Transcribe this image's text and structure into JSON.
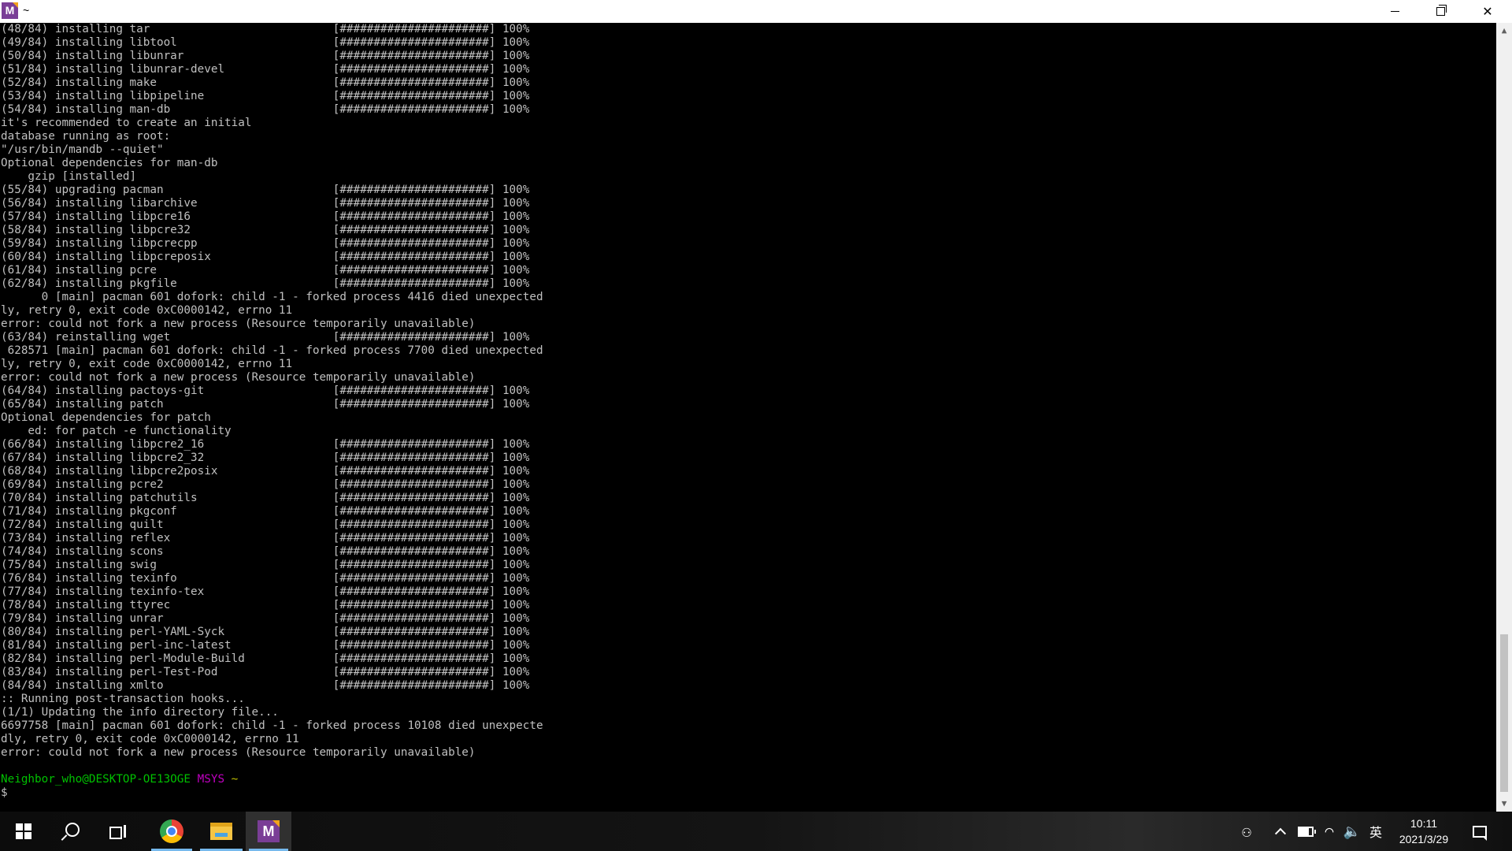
{
  "window": {
    "title": "~",
    "app_icon_letter": "M",
    "close_glyph": "✕"
  },
  "terminal": {
    "lines": [
      "(48/84) installing tar                           [######################] 100%",
      "(49/84) installing libtool                       [######################] 100%",
      "(50/84) installing libunrar                      [######################] 100%",
      "(51/84) installing libunrar-devel                [######################] 100%",
      "(52/84) installing make                          [######################] 100%",
      "(53/84) installing libpipeline                   [######################] 100%",
      "(54/84) installing man-db                        [######################] 100%",
      "it's recommended to create an initial",
      "database running as root:",
      "\"/usr/bin/mandb --quiet\"",
      "Optional dependencies for man-db",
      "    gzip [installed]",
      "(55/84) upgrading pacman                         [######################] 100%",
      "(56/84) installing libarchive                    [######################] 100%",
      "(57/84) installing libpcre16                     [######################] 100%",
      "(58/84) installing libpcre32                     [######################] 100%",
      "(59/84) installing libpcrecpp                    [######################] 100%",
      "(60/84) installing libpcreposix                  [######################] 100%",
      "(61/84) installing pcre                          [######################] 100%",
      "(62/84) installing pkgfile                       [######################] 100%",
      "      0 [main] pacman 601 dofork: child -1 - forked process 4416 died unexpected",
      "ly, retry 0, exit code 0xC0000142, errno 11",
      "error: could not fork a new process (Resource temporarily unavailable)",
      "(63/84) reinstalling wget                        [######################] 100%",
      " 628571 [main] pacman 601 dofork: child -1 - forked process 7700 died unexpected",
      "ly, retry 0, exit code 0xC0000142, errno 11",
      "error: could not fork a new process (Resource temporarily unavailable)",
      "(64/84) installing pactoys-git                   [######################] 100%",
      "(65/84) installing patch                         [######################] 100%",
      "Optional dependencies for patch",
      "    ed: for patch -e functionality",
      "(66/84) installing libpcre2_16                   [######################] 100%",
      "(67/84) installing libpcre2_32                   [######################] 100%",
      "(68/84) installing libpcre2posix                 [######################] 100%",
      "(69/84) installing pcre2                         [######################] 100%",
      "(70/84) installing patchutils                    [######################] 100%",
      "(71/84) installing pkgconf                       [######################] 100%",
      "(72/84) installing quilt                         [######################] 100%",
      "(73/84) installing reflex                        [######################] 100%",
      "(74/84) installing scons                         [######################] 100%",
      "(75/84) installing swig                          [######################] 100%",
      "(76/84) installing texinfo                       [######################] 100%",
      "(77/84) installing texinfo-tex                   [######################] 100%",
      "(78/84) installing ttyrec                        [######################] 100%",
      "(79/84) installing unrar                         [######################] 100%",
      "(80/84) installing perl-YAML-Syck                [######################] 100%",
      "(81/84) installing perl-inc-latest               [######################] 100%",
      "(82/84) installing perl-Module-Build             [######################] 100%",
      "(83/84) installing perl-Test-Pod                 [######################] 100%",
      "(84/84) installing xmlto                         [######################] 100%",
      ":: Running post-transaction hooks...",
      "(1/1) Updating the info directory file...",
      "6697758 [main] pacman 601 dofork: child -1 - forked process 10108 died unexpecte",
      "dly, retry 0, exit code 0xC0000142, errno 11",
      "error: could not fork a new process (Resource temporarily unavailable)",
      ""
    ],
    "prompt": {
      "user_host": "Neighbor_who@DESKTOP-OE13OGE",
      "system": "MSYS",
      "path": "~",
      "symbol": "$"
    }
  },
  "taskbar": {
    "msys_label": "M"
  },
  "tray": {
    "people_glyph": "⚇",
    "wifi_glyph": "◠",
    "volume_glyph": "🔈",
    "ime": "英",
    "time": "10:11",
    "date": "2021/3/29"
  },
  "scrollbar": {
    "up_glyph": "▲",
    "down_glyph": "▼"
  },
  "colors": {
    "prompt_user": "#00c000",
    "prompt_system": "#c000c0",
    "prompt_path": "#c0c000",
    "terminal_text": "#c0c0c0",
    "terminal_bg": "#000000"
  }
}
